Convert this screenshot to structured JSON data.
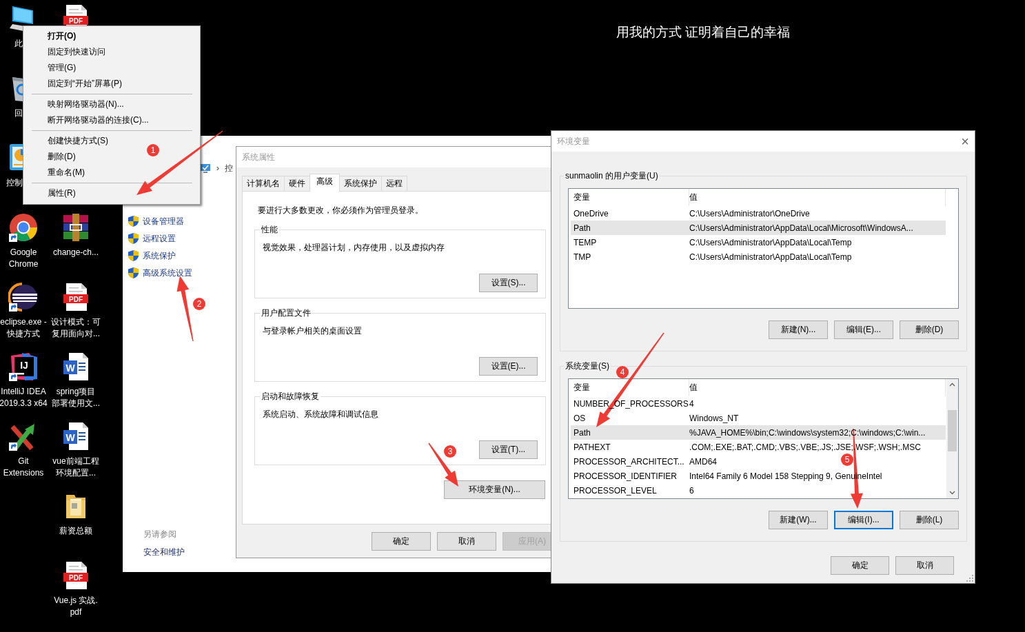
{
  "wallpaper_caption": "用我的方式 证明着自己的幸福",
  "desktop_icons": [
    {
      "kind": "computer",
      "label_lines": [
        "此"
      ],
      "shortcut": false
    },
    {
      "kind": "recycle-bin",
      "label_lines": [
        "回"
      ],
      "shortcut": false
    },
    {
      "kind": "control-panel",
      "label_lines": [
        "控制"
      ],
      "shortcut": false
    },
    {
      "kind": "browser",
      "label_lines": [
        "Google",
        "Chrome"
      ],
      "shortcut": true
    },
    {
      "kind": "eclipse",
      "label_lines": [
        "eclipse.exe -",
        "快捷方式"
      ],
      "shortcut": true
    },
    {
      "kind": "ide",
      "label_lines": [
        "IntelliJ IDEA",
        "2019.3.3 x64"
      ],
      "icon_text": "IJ",
      "shortcut": true
    },
    {
      "kind": "git",
      "label_lines": [
        "Git",
        "Extensions"
      ],
      "shortcut": true
    },
    {
      "kind": "pdf",
      "icon_text": "PDF",
      "shortcut": false
    },
    {
      "kind": "archive",
      "label_lines": [
        "change-ch..."
      ],
      "shortcut": false
    },
    {
      "kind": "pdf",
      "label_lines": [
        "设计模式：可",
        "复用面向对..."
      ],
      "icon_text": "PDF",
      "shortcut": false
    },
    {
      "kind": "word",
      "label_lines": [
        "spring项目",
        "部署使用文..."
      ],
      "icon_text": "W",
      "shortcut": false
    },
    {
      "kind": "word",
      "label_lines": [
        "vue前端工程",
        "环境配置..."
      ],
      "icon_text": "W",
      "shortcut": false
    },
    {
      "kind": "folder",
      "label_lines": [
        "薪资总额"
      ],
      "shortcut": false
    },
    {
      "kind": "pdf",
      "label_lines": [
        "Vue.js 实战.",
        "pdf"
      ],
      "icon_text": "PDF",
      "shortcut": false
    }
  ],
  "control_panel_window": {
    "breadcrumb_separator": "›",
    "breadcrumb": "控",
    "tasks": [
      "设备管理器",
      "远程设置",
      "系统保护",
      "高级系统设置"
    ],
    "see_also_heading": "另请参阅",
    "see_also_links": [
      "安全和维护"
    ]
  },
  "system_properties": {
    "title": "系统属性",
    "tabs": [
      {
        "label": "计算机名",
        "selected": false
      },
      {
        "label": "硬件",
        "selected": false
      },
      {
        "label": "高级",
        "selected": true
      },
      {
        "label": "系统保护",
        "selected": false
      },
      {
        "label": "远程",
        "selected": false
      }
    ],
    "notice": "要进行大多数更改，你必须作为管理员登录。",
    "groups": [
      {
        "title": "性能",
        "description": "视觉效果，处理器计划，内存使用，以及虚拟内存",
        "button": "设置(S)..."
      },
      {
        "title": "用户配置文件",
        "description": "与登录帐户相关的桌面设置",
        "button": "设置(E)..."
      },
      {
        "title": "启动和故障恢复",
        "description": "系统启动、系统故障和调试信息",
        "button": "设置(T)..."
      }
    ],
    "env_button": "环境变量(N)...",
    "buttons": [
      {
        "label": "确定",
        "disabled": false
      },
      {
        "label": "取消",
        "disabled": false
      },
      {
        "label": "应用(A)",
        "disabled": true
      }
    ]
  },
  "environment_variables": {
    "title": "环境变量",
    "close": "×",
    "user_variables": {
      "title": "sunmaolin 的用户变量(U)",
      "columns": [
        "变量",
        "值"
      ],
      "scrollbar": false,
      "rows": [
        {
          "name": "OneDrive",
          "value": "C:\\Users\\Administrator\\OneDrive",
          "selected": false
        },
        {
          "name": "Path",
          "value": "C:\\Users\\Administrator\\AppData\\Local\\Microsoft\\WindowsA...",
          "selected": true
        },
        {
          "name": "TEMP",
          "value": "C:\\Users\\Administrator\\AppData\\Local\\Temp",
          "selected": false
        },
        {
          "name": "TMP",
          "value": "C:\\Users\\Administrator\\AppData\\Local\\Temp",
          "selected": false
        }
      ],
      "buttons": [
        {
          "label": "新建(N)...",
          "focused": false
        },
        {
          "label": "编辑(E)...",
          "focused": false
        },
        {
          "label": "删除(D)",
          "focused": false
        }
      ]
    },
    "system_variables": {
      "title": "系统变量(S)",
      "columns": [
        "变量",
        "值"
      ],
      "scrollbar": true,
      "rows": [
        {
          "name": "NUMBER_OF_PROCESSORS",
          "value": "4",
          "selected": false
        },
        {
          "name": "OS",
          "value": "Windows_NT",
          "selected": false
        },
        {
          "name": "Path",
          "value": "%JAVA_HOME%\\bin;C:\\windows\\system32;C:\\windows;C:\\win...",
          "selected": true
        },
        {
          "name": "PATHEXT",
          "value": ".COM;.EXE;.BAT;.CMD;.VBS;.VBE;.JS;.JSE;.WSF;.WSH;.MSC",
          "selected": false
        },
        {
          "name": "PROCESSOR_ARCHITECT...",
          "value": "AMD64",
          "selected": false
        },
        {
          "name": "PROCESSOR_IDENTIFIER",
          "value": "Intel64 Family 6 Model 158 Stepping 9, GenuineIntel",
          "selected": false
        },
        {
          "name": "PROCESSOR_LEVEL",
          "value": "6",
          "selected": false
        }
      ],
      "buttons": [
        {
          "label": "新建(W)...",
          "focused": false
        },
        {
          "label": "编辑(I)...",
          "focused": true
        },
        {
          "label": "删除(L)",
          "focused": false
        }
      ]
    },
    "buttons": [
      {
        "label": "确定",
        "focused": false
      },
      {
        "label": "取消",
        "focused": false
      }
    ]
  },
  "context_menu": {
    "sections": [
      {
        "items": [
          {
            "label": "打开(O)",
            "default": true
          },
          {
            "label": "固定到快速访问",
            "default": false
          },
          {
            "label": "管理(G)",
            "default": false
          },
          {
            "label": "固定到“开始”屏幕(P)",
            "default": false
          }
        ]
      },
      {
        "items": [
          {
            "label": "映射网络驱动器(N)...",
            "default": false
          },
          {
            "label": "断开网络驱动器的连接(C)...",
            "default": false
          }
        ]
      },
      {
        "items": [
          {
            "label": "创建快捷方式(S)",
            "default": false
          },
          {
            "label": "删除(D)",
            "default": false
          },
          {
            "label": "重命名(M)",
            "default": false
          }
        ]
      },
      {
        "items": [
          {
            "label": "属性(R)",
            "default": false
          }
        ]
      }
    ]
  },
  "annotations": [
    {
      "label": "1"
    },
    {
      "label": "2"
    },
    {
      "label": "3"
    },
    {
      "label": "4"
    },
    {
      "label": "5"
    }
  ]
}
